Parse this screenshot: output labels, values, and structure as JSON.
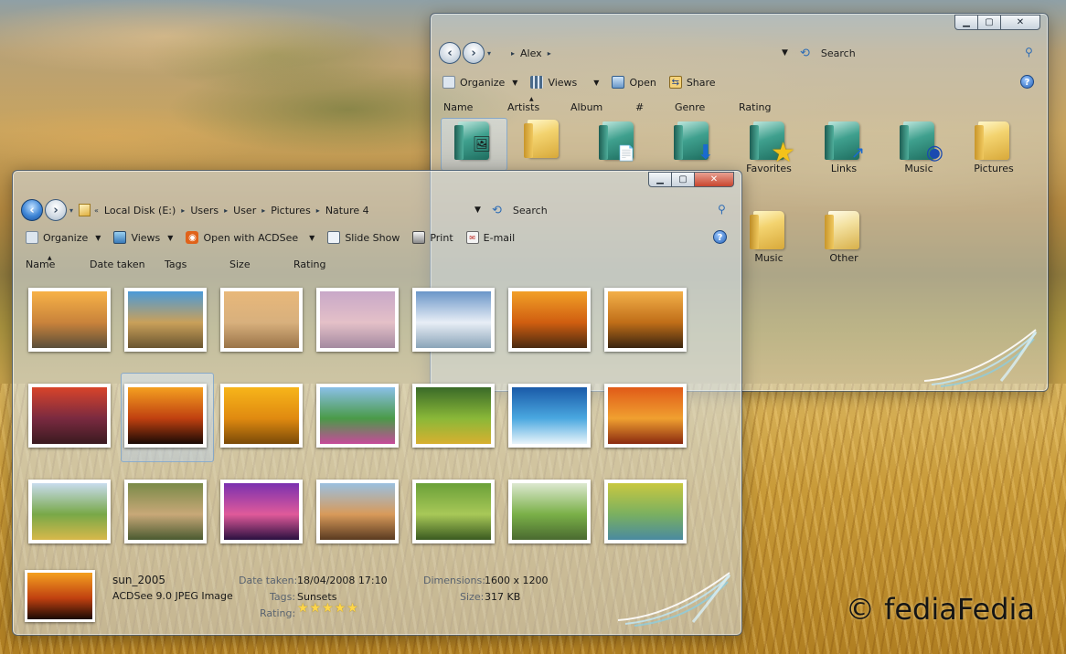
{
  "back_window": {
    "crumb": "Alex",
    "search_placeholder": "Search",
    "toolbar": {
      "organize": "Organize",
      "views": "Views",
      "open": "Open",
      "share": "Share"
    },
    "columns": [
      "Name",
      "Artists",
      "Album",
      "#",
      "Genre",
      "Rating"
    ],
    "row1": [
      {
        "label": "",
        "icon": "app-shortcut-icon"
      },
      {
        "label": "",
        "icon": "folder-icon"
      },
      {
        "label": "",
        "icon": "documents-folder-icon"
      },
      {
        "label": "",
        "icon": "downloads-folder-icon"
      },
      {
        "label": "Favorites",
        "icon": "favorites-folder-icon"
      },
      {
        "label": "Links",
        "icon": "links-folder-icon"
      },
      {
        "label": "Music",
        "icon": "music-folder-icon"
      },
      {
        "label": "Pictures",
        "icon": "pictures-folder-icon"
      }
    ],
    "row2": [
      {
        "label": "Music",
        "icon": "folder-icon"
      },
      {
        "label": "Other",
        "icon": "folder-icon"
      }
    ]
  },
  "front_window": {
    "breadcrumb": [
      "Local Disk (E:)",
      "Users",
      "User",
      "Pictures",
      "Nature 4"
    ],
    "search_placeholder": "Search",
    "toolbar": {
      "organize": "Organize",
      "views": "Views",
      "open_with": "Open with ACDSee",
      "slideshow": "Slide Show",
      "print": "Print",
      "email": "E-mail"
    },
    "columns": [
      "Name",
      "Date taken",
      "Tags",
      "Size",
      "Rating"
    ],
    "thumbnails": [
      {
        "name": "rocky-shore-sunset",
        "colors": [
          "#f7b247",
          "#c9833b",
          "#5a4e3a"
        ]
      },
      {
        "name": "tropical-beach-rocks",
        "colors": [
          "#4b9ad8",
          "#c9a05a",
          "#6a5530"
        ]
      },
      {
        "name": "sand-dunes-beach",
        "colors": [
          "#e8b87a",
          "#d8b07d",
          "#9a7448"
        ]
      },
      {
        "name": "pink-beach-waves",
        "colors": [
          "#c8a8c8",
          "#e4c0c8",
          "#a48aa0"
        ]
      },
      {
        "name": "snowy-forest",
        "colors": [
          "#6a96c8",
          "#e8eef6",
          "#8aa4b8"
        ]
      },
      {
        "name": "misty-sunset-forest",
        "colors": [
          "#f2a028",
          "#d05e10",
          "#4a2a10"
        ]
      },
      {
        "name": "golden-valley-sunset",
        "colors": [
          "#f3b04a",
          "#c06e18",
          "#3a2410"
        ]
      },
      {
        "name": "savanna-tree-sunset",
        "colors": [
          "#d8442a",
          "#7a2a40",
          "#3a1a20"
        ]
      },
      {
        "name": "sun_2005",
        "colors": [
          "#f4a020",
          "#c04010",
          "#1a0a05"
        ]
      },
      {
        "name": "birds-sunset",
        "colors": [
          "#f7b51a",
          "#e08a10",
          "#7a4a08"
        ]
      },
      {
        "name": "mountain-lake-flowers",
        "colors": [
          "#8ac0e8",
          "#4a9a48",
          "#c64a9a"
        ]
      },
      {
        "name": "green-hills-flowers",
        "colors": [
          "#3a6a28",
          "#8ab838",
          "#d8b030"
        ]
      },
      {
        "name": "ocean-wave",
        "colors": [
          "#1a5aa8",
          "#4aa8e0",
          "#e8f4fa"
        ]
      },
      {
        "name": "autumn-forest",
        "colors": [
          "#e05a18",
          "#f0a030",
          "#8a2a10"
        ]
      },
      {
        "name": "lone-tree-field",
        "colors": [
          "#c8dcee",
          "#78a848",
          "#d8b84a"
        ]
      },
      {
        "name": "garden-stairs",
        "colors": [
          "#7a8a48",
          "#c8a878",
          "#4a5a30"
        ]
      },
      {
        "name": "purple-tree-sunset",
        "colors": [
          "#7a30b0",
          "#e05a9a",
          "#2a1040"
        ]
      },
      {
        "name": "island-tree-beach",
        "colors": [
          "#9ac0e0",
          "#d89a5a",
          "#5a3a20"
        ]
      },
      {
        "name": "oak-tree-meadow",
        "colors": [
          "#6aa038",
          "#a8c858",
          "#3a5a20"
        ]
      },
      {
        "name": "forest-path-rocks",
        "colors": [
          "#dce8d0",
          "#7ab048",
          "#4a6a30"
        ]
      },
      {
        "name": "autumn-river-trees",
        "colors": [
          "#c8c840",
          "#7ab060",
          "#4a8aa0"
        ]
      }
    ],
    "selected_index": 8,
    "details": {
      "filename": "sun_2005",
      "filetype": "ACDSee 9.0 JPEG Image",
      "date_taken_label": "Date taken:",
      "date_taken": "18/04/2008 17:10",
      "tags_label": "Tags:",
      "tags": "Sunsets",
      "rating_label": "Rating:",
      "rating": 5,
      "stars": "★★★★★",
      "dimensions_label": "Dimensions:",
      "dimensions": "1600 x 1200",
      "size_label": "Size:",
      "size": "317 KB"
    }
  },
  "watermark": "© fediaFedia"
}
